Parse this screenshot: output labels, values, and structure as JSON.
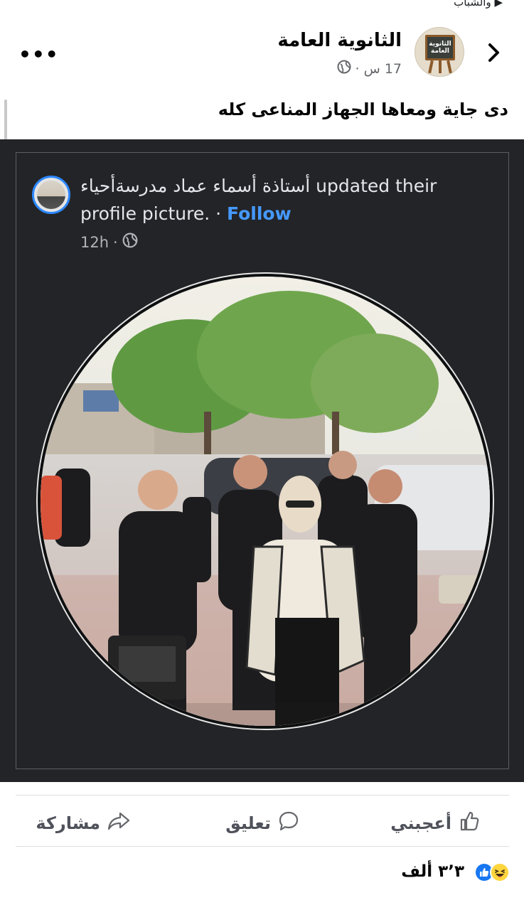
{
  "top_fragment": "▶ والشباب",
  "header": {
    "page_name": "الثانوية العامة",
    "avatar_text": "الثانوية العامة",
    "time": "17 س",
    "audience_icon": "globe-icon",
    "more_icon": "more-icon"
  },
  "post": {
    "caption": "دى جاية ومعاها الجهاز المناعى كله"
  },
  "embedded": {
    "name": "أستاذة أسماء عماد مدرسةأحياء",
    "action_text": "updated their",
    "action_text_2": "profile picture.",
    "separator": "·",
    "follow": "Follow",
    "time": "12h",
    "colors": {
      "background": "#232427",
      "follow": "#4599ff",
      "avatar_ring": "#2d88ff"
    }
  },
  "actions": {
    "like": "أعجبني",
    "comment": "تعليق",
    "share": "مشاركة"
  },
  "reactions": {
    "count": "٣٬٣ ألف",
    "icons": [
      "like-icon",
      "haha-icon"
    ]
  }
}
